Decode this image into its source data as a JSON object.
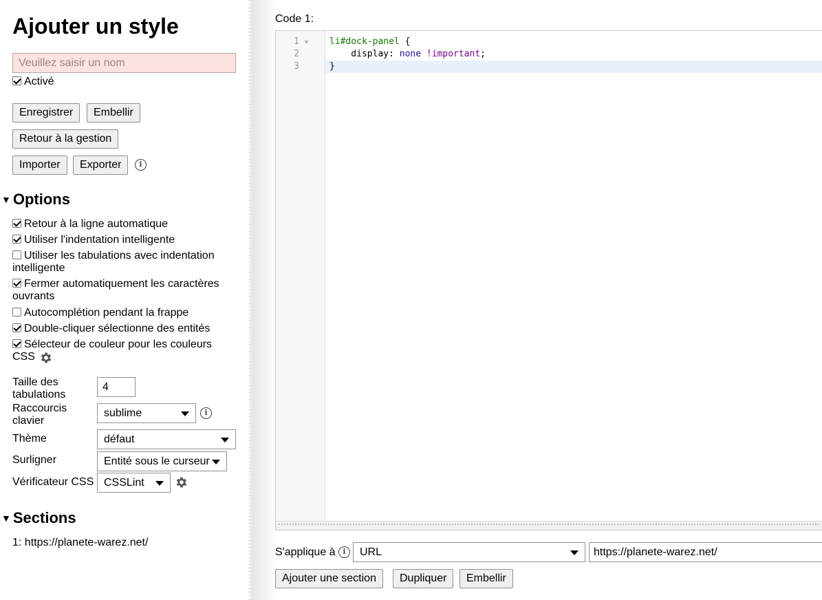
{
  "sidebar": {
    "title": "Ajouter un style",
    "name_placeholder": "Veuillez saisir un nom",
    "enabled_label": "Activé",
    "buttons": {
      "save": "Enregistrer",
      "beautify": "Embellir",
      "back": "Retour à la gestion",
      "import": "Importer",
      "export": "Exporter"
    },
    "options": {
      "heading": "Options",
      "checkboxes": [
        {
          "label": "Retour à la ligne automatique",
          "checked": true
        },
        {
          "label": "Utiliser l'indentation intelligente",
          "checked": true
        },
        {
          "label": "Utiliser les tabulations avec indentation intelligente",
          "checked": false
        },
        {
          "label": "Fermer automatiquement les caractères ouvrants",
          "checked": true
        },
        {
          "label": "Autocomplétion pendant la frappe",
          "checked": false
        },
        {
          "label": "Double-cliquer sélectionne des entités",
          "checked": true
        },
        {
          "label": "Sélecteur de couleur pour les couleurs CSS",
          "checked": true
        }
      ],
      "tab_size_label": "Taille des tabulations",
      "tab_size_value": "4",
      "keymap_label": "Raccourcis clavier",
      "keymap_value": "sublime",
      "theme_label": "Thème",
      "theme_value": "défaut",
      "highlight_label": "Surligner",
      "highlight_value": "Entité sous le curseur",
      "linter_label": "Vérificateur CSS",
      "linter_value": "CSSLint"
    },
    "sections": {
      "heading": "Sections",
      "items": [
        "1: https://planete-warez.net/"
      ]
    }
  },
  "main": {
    "code_label": "Code 1:",
    "line_numbers": [
      "1",
      "2",
      "3"
    ],
    "code": {
      "l1_selector": "li#dock-panel",
      "l1_brace": " {",
      "l2_property": "    display:",
      "l2_value": " none",
      "l2_important": " !important",
      "l2_semicolon": ";",
      "l3_brace": "}"
    },
    "applies_label": "S'applique à",
    "applies_type": "URL",
    "applies_value": "https://planete-warez.net/",
    "buttons": {
      "add_section": "Ajouter une section",
      "duplicate": "Dupliquer",
      "beautify": "Embellir"
    }
  }
}
